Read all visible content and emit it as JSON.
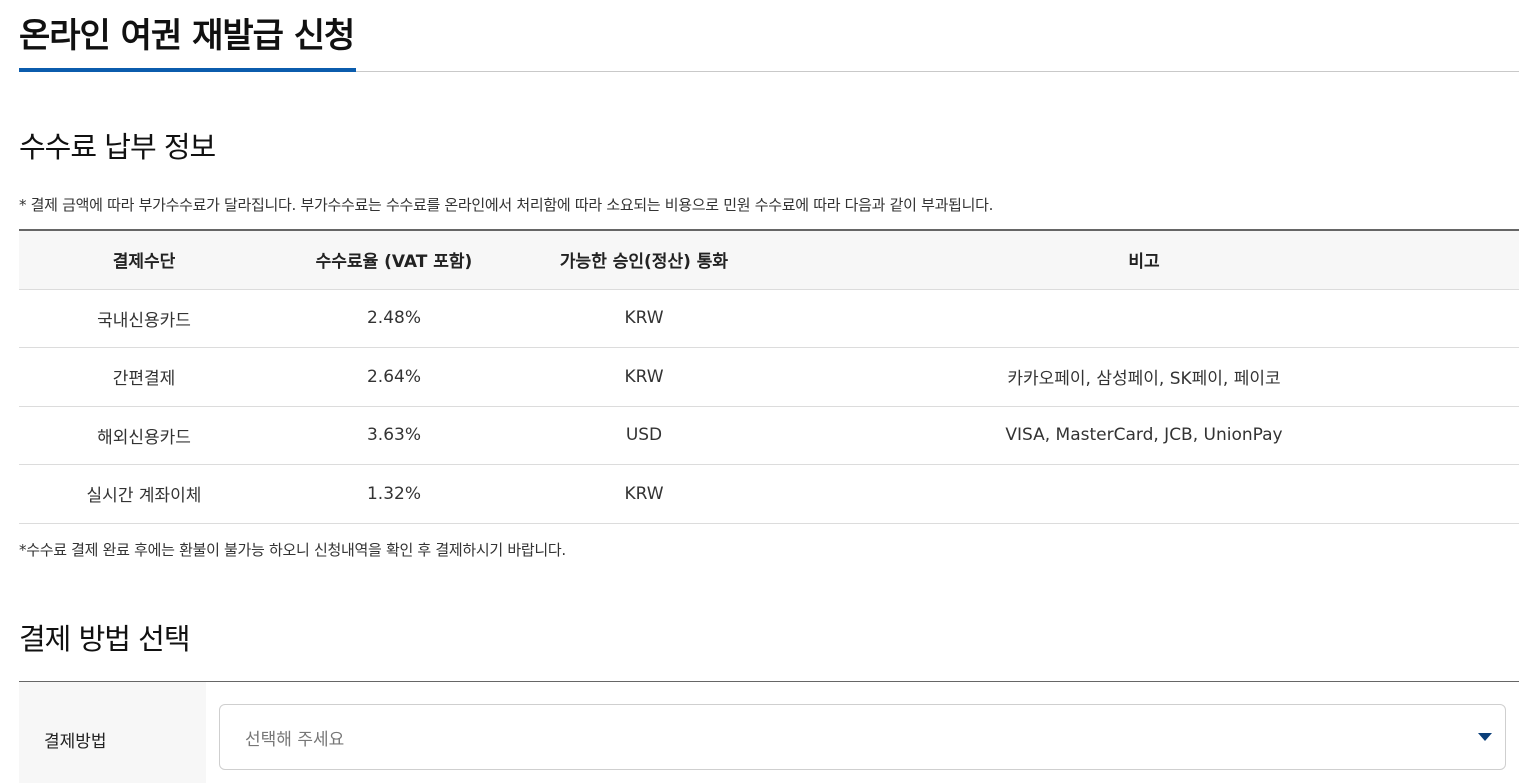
{
  "header": {
    "title": "온라인 여권 재발급 신청"
  },
  "fee_section": {
    "heading": "수수료 납부 정보",
    "note_top": "* 결제 금액에 따라 부가수수료가 달라집니다. 부가수수료는 수수료를 온라인에서 처리함에 따라 소요되는 비용으로 민원 수수료에 따라 다음과 같이 부과됩니다.",
    "table": {
      "headers": [
        "결제수단",
        "수수료율 (VAT 포함)",
        "가능한 승인(정산) 통화",
        "비고"
      ],
      "rows": [
        [
          "국내신용카드",
          "2.48%",
          "KRW",
          ""
        ],
        [
          "간편결제",
          "2.64%",
          "KRW",
          "카카오페이, 삼성페이, SK페이, 페이코"
        ],
        [
          "해외신용카드",
          "3.63%",
          "USD",
          "VISA, MasterCard, JCB, UnionPay"
        ],
        [
          "실시간 계좌이체",
          "1.32%",
          "KRW",
          ""
        ]
      ]
    },
    "note_bottom": "*수수료 결제 완료 후에는 환불이 불가능 하오니 신청내역을 확인 후 결제하시기 바랍니다."
  },
  "payment_section": {
    "heading": "결제 방법 선택",
    "label": "결제방법",
    "select_placeholder": "선택해 주세요",
    "caret_icon": "caret-down-icon"
  },
  "colors": {
    "accent": "#0b5cad",
    "caret": "#0b3f7a",
    "header_bg": "#f7f7f7"
  }
}
